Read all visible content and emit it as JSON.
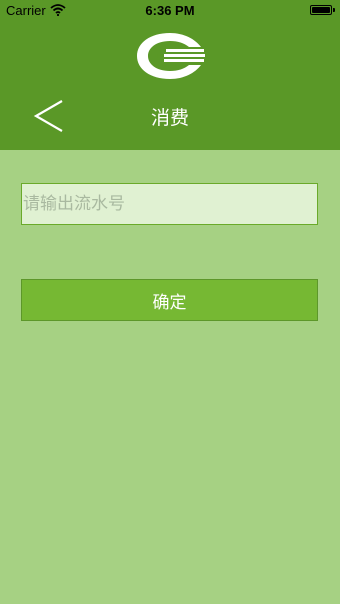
{
  "status_bar": {
    "carrier": "Carrier",
    "time": "6:36 PM",
    "wifi_icon": "wifi-icon",
    "battery_icon": "battery-icon"
  },
  "header": {
    "logo_icon": "brand-logo",
    "back_icon": "chevron-left-icon",
    "title": "消费"
  },
  "form": {
    "serial_placeholder": "请输出流水号",
    "serial_value": "",
    "confirm_label": "确定"
  },
  "colors": {
    "header_bg": "#5a9827",
    "page_bg": "#a6d183",
    "button_bg": "#76b833",
    "input_bg": "#e0f1d2"
  }
}
